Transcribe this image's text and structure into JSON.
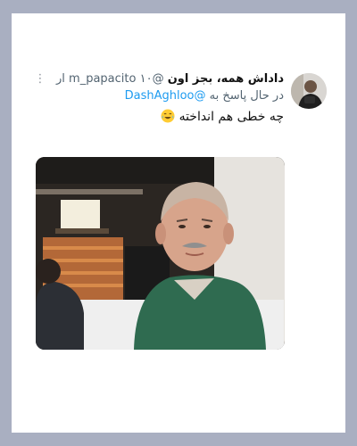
{
  "tweet": {
    "display_name": "داداش همه، بجز اون",
    "handle": "@m_papacito",
    "time": "۱۰ ار",
    "more_icon": "more-vertical-icon",
    "reply_prefix": "در حال پاسخ به",
    "reply_handle": "@DashAghloo",
    "text": "چه خطی هم انداخته",
    "emoji": "laughing-tears-emoji"
  },
  "colors": {
    "background": "#a9afc1",
    "card": "#ffffff",
    "link": "#1d9bf0",
    "muted": "#536471"
  }
}
